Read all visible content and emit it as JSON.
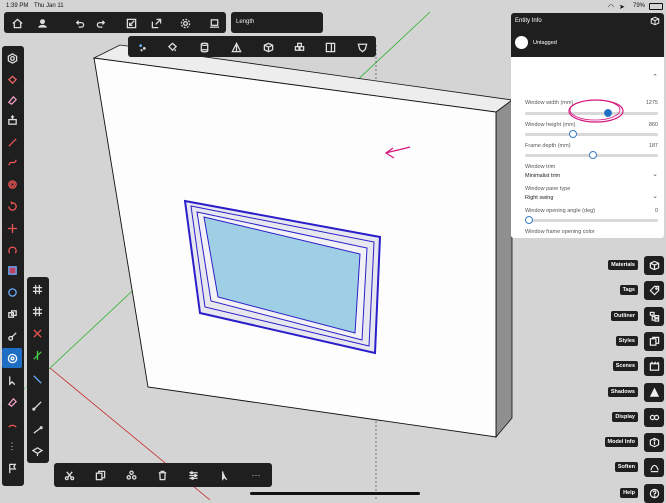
{
  "status": {
    "time": "1:39 PM",
    "date": "Thu Jan 11",
    "battery": "79%"
  },
  "toolbar": {
    "view_name": "Length"
  },
  "entity_info": {
    "title": "Entity Info",
    "tag": "Untagged",
    "window_width": {
      "label": "Window width (mm)",
      "value": "1275",
      "level": 0.62
    },
    "window_height": {
      "label": "Window height (mm)",
      "value": "860",
      "level": 0.35
    },
    "frame_depth": {
      "label": "Frame depth (mm)",
      "value": "187",
      "level": 0.5
    },
    "window_trim": {
      "label": "Window trim",
      "value": "Minimalist trim"
    },
    "window_pane_type": {
      "label": "Window pane type",
      "value": "Right swing"
    },
    "opening_angle": {
      "label": "Window opening angle (deg)",
      "value": "0",
      "level": 0.0
    },
    "frame_color": {
      "label": "Window frame opening color"
    }
  },
  "right_panel": [
    {
      "label": "Materials",
      "icon": "materials-icon"
    },
    {
      "label": "Tags",
      "icon": "tags-icon"
    },
    {
      "label": "Outliner",
      "icon": "outliner-icon"
    },
    {
      "label": "Styles",
      "icon": "styles-icon"
    },
    {
      "label": "Scenes",
      "icon": "scenes-icon"
    },
    {
      "label": "Shadows",
      "icon": "shadows-icon"
    },
    {
      "label": "Display",
      "icon": "display-icon"
    },
    {
      "label": "Model Info",
      "icon": "model-info-icon"
    },
    {
      "label": "Soften",
      "icon": "soften-icon"
    },
    {
      "label": "Help",
      "icon": "help-icon"
    }
  ],
  "colors": {
    "toolbar": "#1f1f1f",
    "accent": "#1e6fc4",
    "annotation": "#d6187f",
    "glass": "#9fcfe5",
    "frame_outline": "#2a1fc9"
  }
}
